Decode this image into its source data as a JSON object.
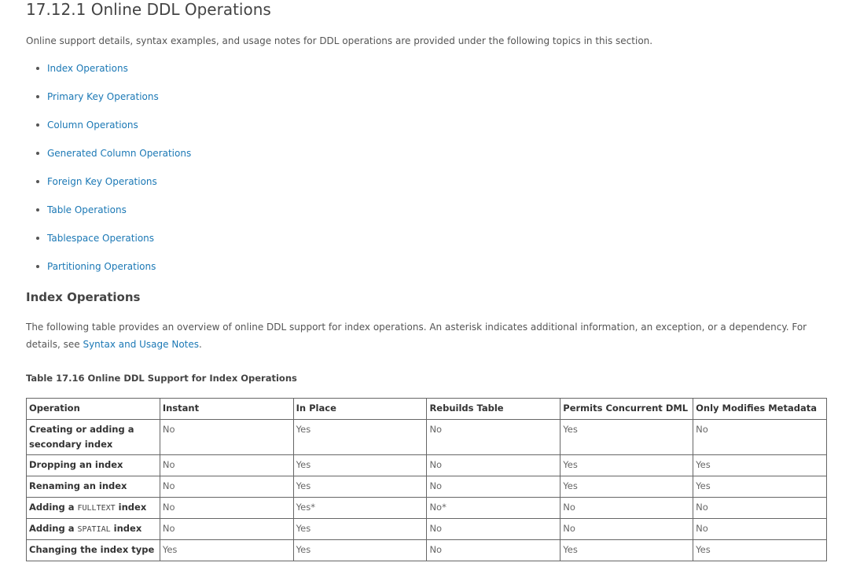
{
  "section": {
    "title": "17.12.1 Online DDL Operations",
    "intro": "Online support details, syntax examples, and usage notes for DDL operations are provided under the following topics in this section."
  },
  "toc": [
    "Index Operations",
    "Primary Key Operations",
    "Column Operations",
    "Generated Column Operations",
    "Foreign Key Operations",
    "Table Operations",
    "Tablespace Operations",
    "Partitioning Operations"
  ],
  "index_ops": {
    "title": "Index Operations",
    "overview_text": "The following table provides an overview of online DDL support for index operations. An asterisk indicates additional information, an exception, or a dependency. For details, see ",
    "overview_link": "Syntax and Usage Notes",
    "overview_end": "."
  },
  "table": {
    "caption": "Table 17.16 Online DDL Support for Index Operations",
    "headers": [
      "Operation",
      "Instant",
      "In Place",
      "Rebuilds Table",
      "Permits Concurrent DML",
      "Only Modifies Metadata"
    ],
    "rows": [
      {
        "op_pre": "Creating or adding a secondary index",
        "op_code": "",
        "op_post": "",
        "values": [
          "No",
          "Yes",
          "No",
          "Yes",
          "No"
        ]
      },
      {
        "op_pre": "Dropping an index",
        "op_code": "",
        "op_post": "",
        "values": [
          "No",
          "Yes",
          "No",
          "Yes",
          "Yes"
        ]
      },
      {
        "op_pre": "Renaming an index",
        "op_code": "",
        "op_post": "",
        "values": [
          "No",
          "Yes",
          "No",
          "Yes",
          "Yes"
        ]
      },
      {
        "op_pre": "Adding a ",
        "op_code": "FULLTEXT",
        "op_post": " index",
        "values": [
          "No",
          "Yes*",
          "No*",
          "No",
          "No"
        ]
      },
      {
        "op_pre": "Adding a ",
        "op_code": "SPATIAL",
        "op_post": " index",
        "values": [
          "No",
          "Yes",
          "No",
          "No",
          "No"
        ]
      },
      {
        "op_pre": "Changing the index type",
        "op_code": "",
        "op_post": "",
        "values": [
          "Yes",
          "Yes",
          "No",
          "Yes",
          "Yes"
        ]
      }
    ]
  }
}
